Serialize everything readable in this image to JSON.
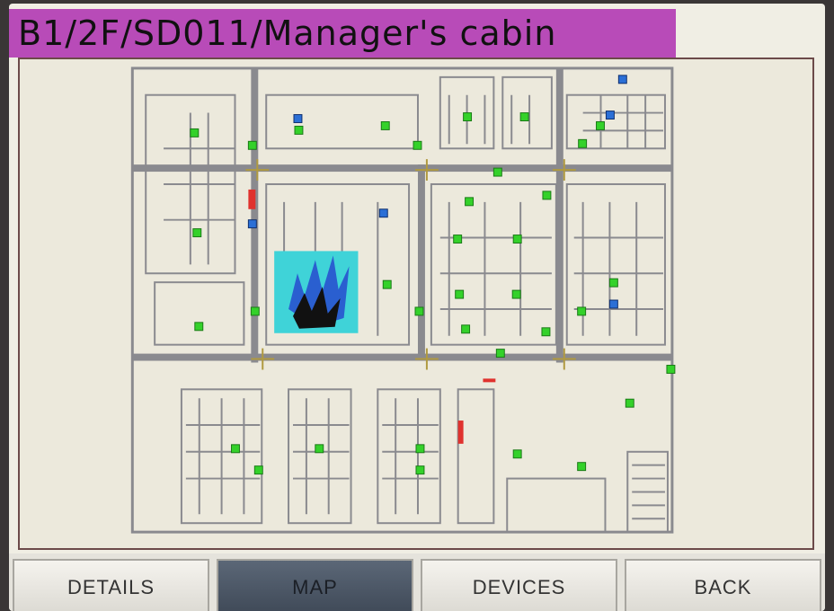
{
  "header": {
    "title": "B1/2F/SD011/Manager's cabin"
  },
  "colors": {
    "title_bg": "#b84bb8",
    "device": "#34d12a",
    "device_selected": "#2b6fd6",
    "alarm": "#e0322e",
    "fire_zone": "#3fd3d8"
  },
  "icons": {
    "fire": "fire-alarm-icon",
    "device": "detector-icon"
  },
  "nav": {
    "details": "DETAILS",
    "map": "MAP",
    "devices": "DEVICES",
    "back": "BACK",
    "active": "map"
  }
}
